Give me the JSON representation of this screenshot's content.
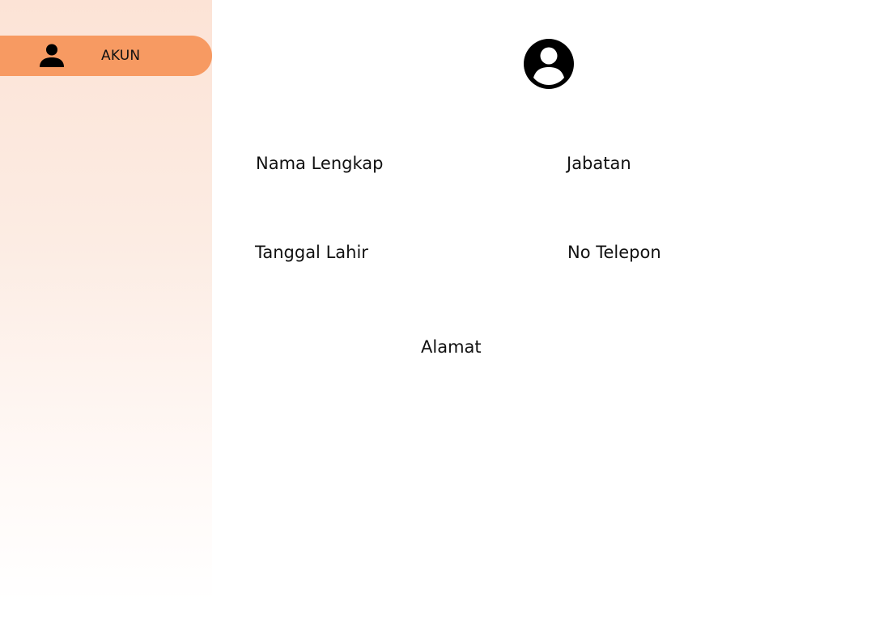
{
  "sidebar": {
    "items": [
      {
        "label": "AKUN",
        "icon": "person-icon",
        "active": true
      }
    ],
    "active_color": "#f79a62",
    "background_color": "#fce3d6"
  },
  "profile": {
    "avatar_icon": "account-circle-icon",
    "fields": {
      "nama_lengkap": "Nama Lengkap",
      "jabatan": "Jabatan",
      "tanggal_lahir": "Tanggal Lahir",
      "no_telepon": "No Telepon",
      "alamat": "Alamat"
    }
  }
}
